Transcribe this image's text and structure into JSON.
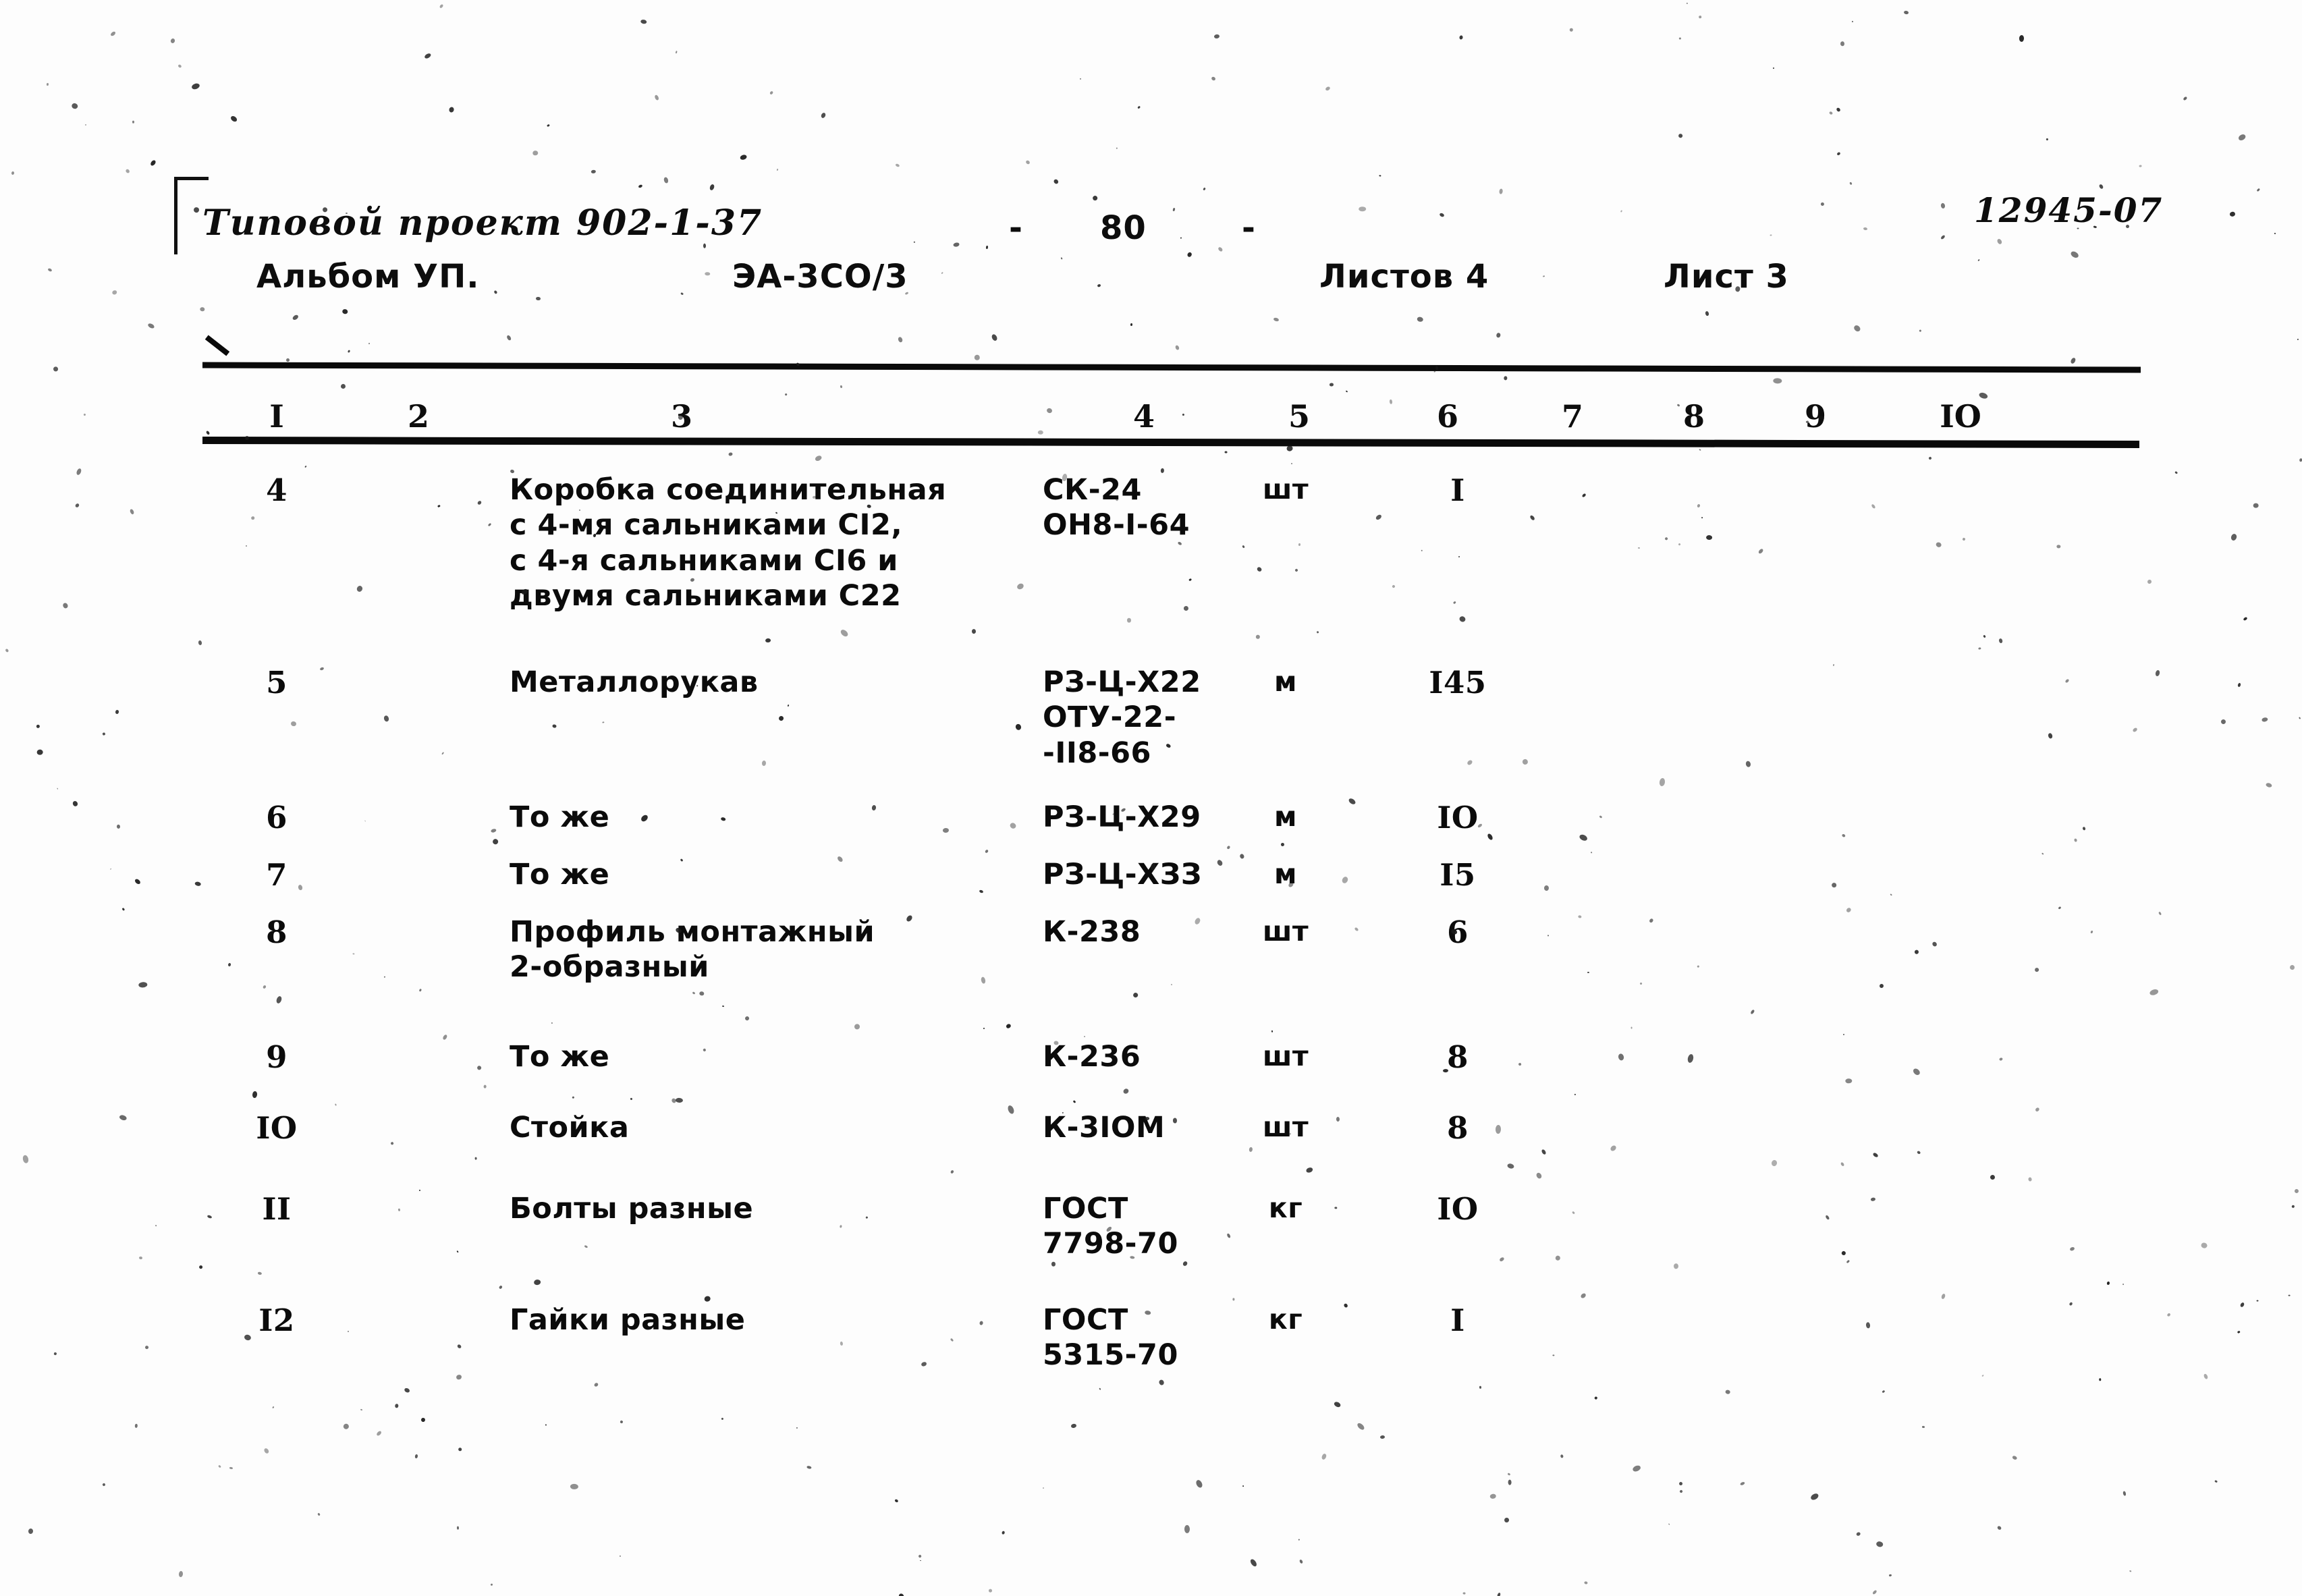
{
  "header": {
    "project_label": "Типовой проект 902-1-37",
    "album_label": "Альбом УП.",
    "code_label": "ЭА-3СО/3",
    "center_dash_left": "-",
    "page_number": "80",
    "center_dash_right": "-",
    "sheets_total": "Листов 4",
    "sheet_current": "Лист 3",
    "stamp_number": "12945-07"
  },
  "table": {
    "column_numbers": [
      "I",
      "2",
      "3",
      "4",
      "5",
      "6",
      "7",
      "8",
      "9",
      "IO"
    ],
    "rows": [
      {
        "no": "4",
        "name": "Коробка соединительная\nс 4-мя сальниками СI2,\nс 4-я сальниками СI6 и\nдвумя сальниками С22",
        "code": "СК-24\nОН8-I-64",
        "unit": "шт",
        "qty": "I"
      },
      {
        "no": "5",
        "name": "Металлорукав",
        "code": "РЗ-Ц-Х22\nОТУ-22-\n-II8-66",
        "unit": "м",
        "qty": "I45"
      },
      {
        "no": "6",
        "name": "То же",
        "code": "РЗ-Ц-Х29",
        "unit": "м",
        "qty": "IO"
      },
      {
        "no": "7",
        "name": "То же",
        "code": "РЗ-Ц-ХЗЗ",
        "unit": "м",
        "qty": "I5"
      },
      {
        "no": "8",
        "name": "Профиль монтажный\n2-образный",
        "code": "К-238",
        "unit": "шт",
        "qty": "6"
      },
      {
        "no": "9",
        "name": "То же",
        "code": "К-236",
        "unit": "шт",
        "qty": "8"
      },
      {
        "no": "IO",
        "name": "Стойка",
        "code": "К-3IOМ",
        "unit": "шт",
        "qty": "8"
      },
      {
        "no": "II",
        "name": "Болты разные",
        "code": "ГОСТ\n7798-70",
        "unit": "кг",
        "qty": "IO"
      },
      {
        "no": "I2",
        "name": "Гайки разные",
        "code": "ГОСТ\n5315-70",
        "unit": "кг",
        "qty": "I"
      }
    ]
  },
  "layout": {
    "column_x": [
      410,
      620,
      1010,
      1695,
      1925,
      2145,
      2330,
      2510,
      2690,
      2905
    ],
    "cell_x": {
      "no": 410,
      "name": 755,
      "code": 1545,
      "unit": 1905,
      "qty": 2160
    },
    "row_y": [
      700,
      985,
      1185,
      1270,
      1355,
      1540,
      1645,
      1765,
      1930
    ],
    "ink_color": "#0b0b0b",
    "paper_color": "#fdfdfd"
  }
}
